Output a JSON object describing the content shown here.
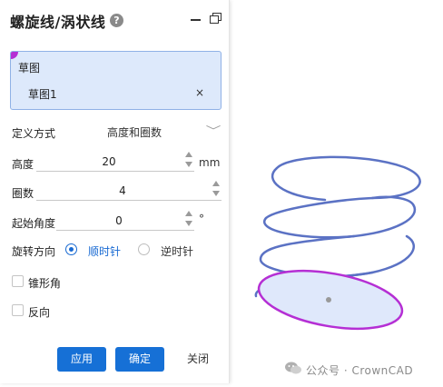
{
  "dialog": {
    "title": "螺旋线/涡状线",
    "help_icon": "help-circle-icon",
    "minimize_icon": "minimize-icon",
    "restore_icon": "restore-window-icon"
  },
  "sketch": {
    "label": "草图",
    "item": "草图1",
    "remove": "×"
  },
  "definition": {
    "label": "定义方式",
    "value": "高度和圈数",
    "chevron": "﹀"
  },
  "height": {
    "label": "高度",
    "value": "20",
    "unit": "mm"
  },
  "turns": {
    "label": "圈数",
    "value": "4"
  },
  "start_angle": {
    "label": "起始角度",
    "value": "0",
    "unit": "°"
  },
  "direction": {
    "label": "旋转方向",
    "clockwise": "顺时针",
    "counterclockwise": "逆时针",
    "selected": "clockwise"
  },
  "taper": {
    "label": "锥形角",
    "checked": false
  },
  "reverse": {
    "label": "反向",
    "checked": false
  },
  "buttons": {
    "apply": "应用",
    "ok": "确定",
    "close": "关闭"
  },
  "watermark": {
    "text": "公众号 · CrownCAD"
  },
  "colors": {
    "accent": "#1670d6",
    "helix": "#5b72c4",
    "base_circle": "#b52fd4",
    "base_fill": "#dfe8fb",
    "sketch_bg": "#dde9fb"
  }
}
